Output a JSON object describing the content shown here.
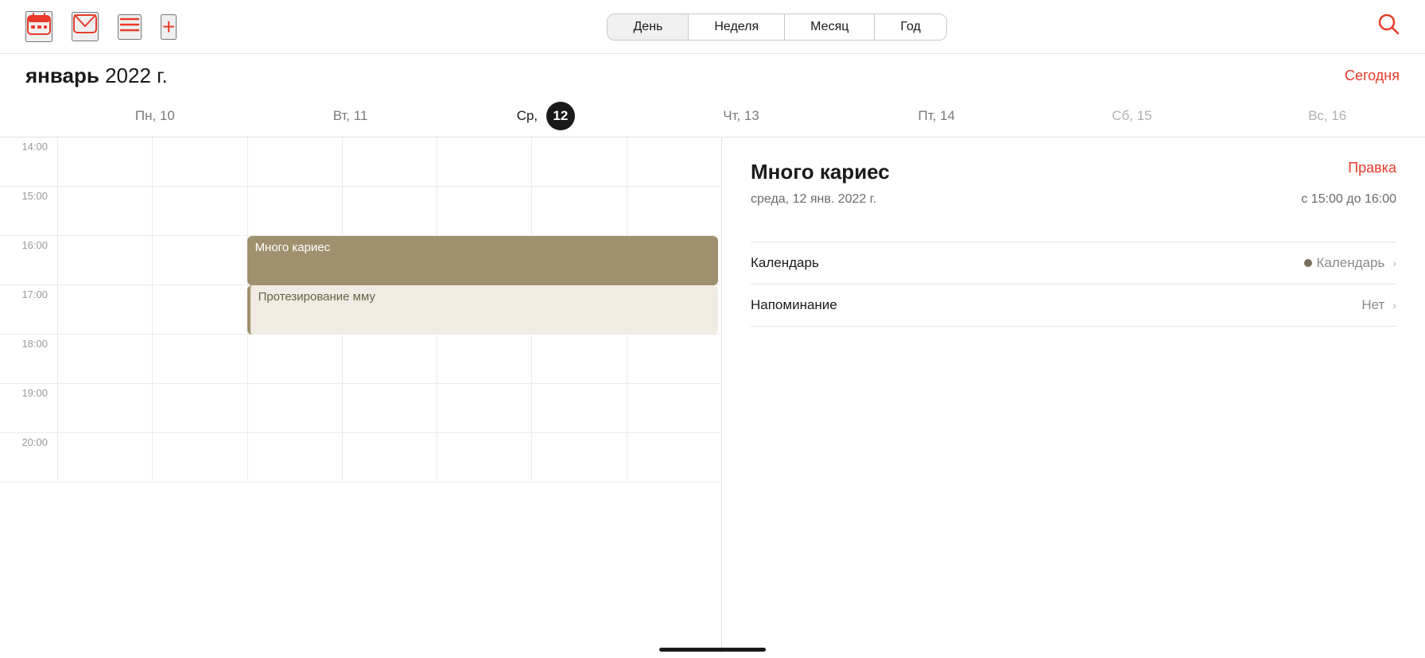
{
  "toolbar": {
    "calendar_icon": "📅",
    "inbox_icon": "📨",
    "list_icon": "≡",
    "add_icon": "+",
    "search_icon": "🔍",
    "view_buttons": [
      {
        "label": "День",
        "active": true
      },
      {
        "label": "Неделя",
        "active": false
      },
      {
        "label": "Месяц",
        "active": false
      },
      {
        "label": "Год",
        "active": false
      }
    ]
  },
  "header": {
    "month_bold": "январь",
    "year": " 2022 г.",
    "today_btn": "Сегодня"
  },
  "days": [
    {
      "short": "Пн,",
      "num": "10",
      "today": false,
      "weekend": false
    },
    {
      "short": "Вт,",
      "num": "11",
      "today": false,
      "weekend": false
    },
    {
      "short": "Ср,",
      "num": "12",
      "today": true,
      "weekend": false
    },
    {
      "short": "Чт,",
      "num": "13",
      "today": false,
      "weekend": false
    },
    {
      "short": "Пт,",
      "num": "14",
      "today": false,
      "weekend": false
    },
    {
      "short": "Сб,",
      "num": "15",
      "today": false,
      "weekend": true
    },
    {
      "short": "Вс,",
      "num": "16",
      "today": false,
      "weekend": true
    }
  ],
  "time_labels": [
    "14:00",
    "15:00",
    "16:00",
    "17:00",
    "18:00",
    "19:00",
    "20:00"
  ],
  "events": {
    "event1": {
      "title": "Много кариес",
      "color": "#a0916e",
      "text_color": "#ffffff"
    },
    "event2": {
      "title": "Протезирование мму",
      "color": "#f0ece3",
      "text_color": "#6b6048"
    }
  },
  "detail_panel": {
    "title": "Много кариес",
    "edit_btn": "Правка",
    "date": "среда, 12 янв. 2022 г.",
    "time": "с 15:00 до 16:00",
    "calendar_label": "Календарь",
    "calendar_value": "Календарь",
    "reminder_label": "Напоминание",
    "reminder_value": "Нет"
  }
}
